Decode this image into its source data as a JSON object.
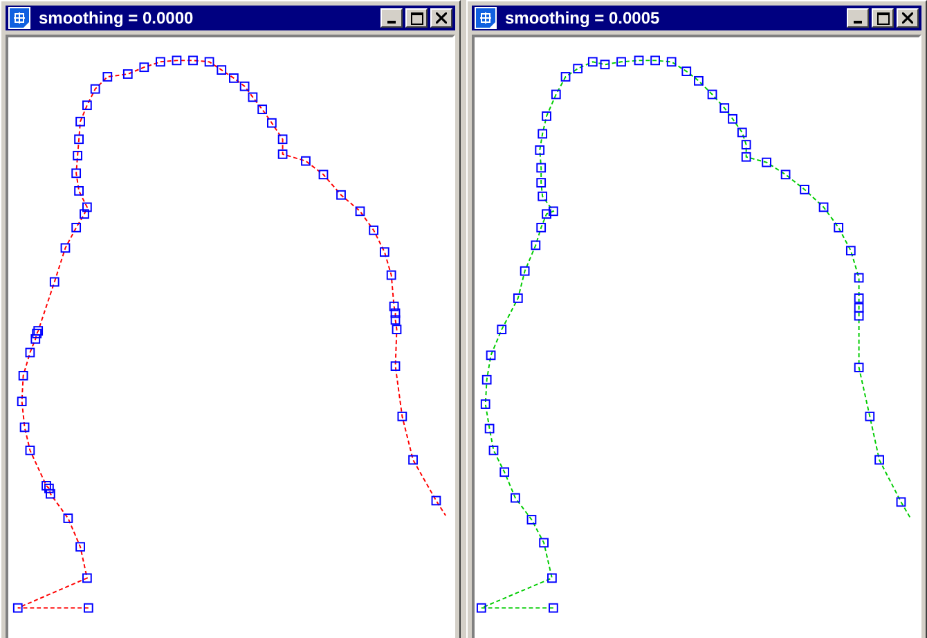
{
  "windows": [
    {
      "title": "smoothing = 0.0000",
      "color": "#ff0000"
    },
    {
      "title": "smoothing = 0.0005",
      "color": "#00cc00"
    }
  ]
}
